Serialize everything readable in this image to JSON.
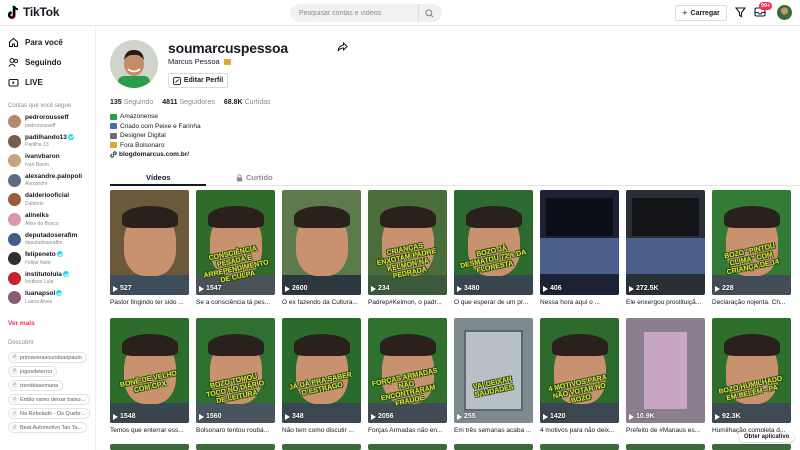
{
  "header": {
    "logo_text": "TikTok",
    "search_placeholder": "Pesquisar contas e vídeos",
    "upload_label": "Carregar",
    "inbox_badge": "99+"
  },
  "sidebar": {
    "nav": [
      {
        "label": "Para você",
        "icon": "home-icon"
      },
      {
        "label": "Seguindo",
        "icon": "following-icon"
      },
      {
        "label": "LIVE",
        "icon": "live-icon"
      }
    ],
    "following_title": "Contas que você segue",
    "accounts": [
      {
        "name": "pedrorousseff",
        "sub": "pedrorousseff",
        "verified": false,
        "color": "#b58a6a"
      },
      {
        "name": "padilhando13",
        "sub": "Padilha 13",
        "verified": true,
        "color": "#7a5c4a"
      },
      {
        "name": "ivanvbaron",
        "sub": "Ivan Baron",
        "verified": false,
        "color": "#c7a37f"
      },
      {
        "name": "alexandre.palopoli",
        "sub": "Alexandre",
        "verified": false,
        "color": "#5b6d7e"
      },
      {
        "name": "dalderiooficial",
        "sub": "Dalderio",
        "verified": false,
        "color": "#9c5a3e"
      },
      {
        "name": "alinelks",
        "sub": "Aline do Bosco",
        "verified": false,
        "color": "#d69aa8"
      },
      {
        "name": "deputadoserafim",
        "sub": "deputadoserafim",
        "verified": false,
        "color": "#3c5f8c"
      },
      {
        "name": "felipeneto",
        "sub": "Felipe Neto",
        "verified": true,
        "color": "#2f2f34"
      },
      {
        "name": "institutolula",
        "sub": "Instituto Lula",
        "verified": true,
        "color": "#c8222c"
      },
      {
        "name": "luanapsol",
        "sub": "Luana Alves",
        "verified": true,
        "color": "#8c5a73"
      }
    ],
    "see_more": "Ver mais",
    "discover_title": "Descobrir",
    "discover": [
      {
        "label": "primaverasoundsaopaulo",
        "icon": "#"
      },
      {
        "label": "jogosdeterror",
        "icon": "#"
      },
      {
        "label": "trenddasemana",
        "icon": "#"
      },
      {
        "label": "Então vamo deixar baixo...",
        "icon": "♫"
      },
      {
        "label": "Na Rebolado - Os Quebr...",
        "icon": "♫"
      },
      {
        "label": "Beat Automotivo Tan Ta...",
        "icon": "♫"
      }
    ]
  },
  "profile": {
    "username": "soumarcuspessoa",
    "display_name": "Marcus Pessoa",
    "edit_label": "Editar Perfil",
    "stats": [
      {
        "value": "135",
        "label": "Seguindo"
      },
      {
        "value": "4811",
        "label": "Seguidores"
      },
      {
        "value": "68.8K",
        "label": "Curtidas"
      }
    ],
    "bio": [
      {
        "text": "Amazonense",
        "color": "#2e9d3a"
      },
      {
        "text": "Criado com Peixe e Farinha",
        "color": "#4a6fb0"
      },
      {
        "text": "Designer Digital",
        "color": "#6b6b6b"
      },
      {
        "text": "Fora Bolsonaro",
        "color": "#e0a82e"
      }
    ],
    "link": "blogdomarcus.com.br/"
  },
  "tabs": {
    "videos": "Vídeos",
    "liked": "Curtido"
  },
  "videos": [
    {
      "plays": "527",
      "caption": "Pastor fingindo ter sido ...",
      "overlay": "",
      "bg": "#6b5a3a",
      "shirt": "#3e4d5c"
    },
    {
      "plays": "1547",
      "caption": "Se a consciência tá pes...",
      "overlay": "CONSCIÊNCIA PESADA É ARREPENDIMENTO DE CULPA",
      "bg": "#2f6b2a",
      "shirt": "#4a5358"
    },
    {
      "plays": "2600",
      "caption": "O ex fazendo da Cultura...",
      "overlay": "",
      "bg": "#5c7a4c",
      "shirt": "#2e3740"
    },
    {
      "plays": "234",
      "caption": "Padrep#Kelmon, o padr...",
      "overlay": "CRIANÇAS ENXOTAM PADRE KELMON NA PEDRADA",
      "bg": "#4a6e3a",
      "shirt": "#3b5a3a"
    },
    {
      "plays": "3480",
      "caption": "O que esperar de um pr...",
      "overlay": "BOZO JÁ DESMATOU 72% DA FLORESTA",
      "bg": "#2c6a2f",
      "shirt": "#39464f"
    },
    {
      "plays": "406",
      "caption": "Nessa hora aqui o ...",
      "overlay": "",
      "bg": "#1c2233",
      "shirt": "#1c2233"
    },
    {
      "plays": "272.5K",
      "caption": "Ele enxergou prostituiçã...",
      "overlay": "",
      "bg": "#2a2e36",
      "shirt": "#2a2e36"
    },
    {
      "plays": "228",
      "caption": "Declaração nojenta. Ch...",
      "overlay": "BOZO \"PINTOU CLIMA\" COM CRIANÇA DE 14",
      "bg": "#327a35",
      "shirt": "#424d58"
    },
    {
      "plays": "1548",
      "caption": "Temos que enterrar ess...",
      "overlay": "BONÉ DE VELHO COM CPX",
      "bg": "#2d6d2c",
      "shirt": "#39454f"
    },
    {
      "plays": "1560",
      "caption": "Bolsonaro tentou roubá...",
      "overlay": "BOZO TOMOU TOCO NO DIÁRIO DE LEITURA",
      "bg": "#2f7030",
      "shirt": "#48545e"
    },
    {
      "plays": "348",
      "caption": "Não tem como discutir ...",
      "overlay": "JÁ DÁ PRA SABER O ESTRAGO",
      "bg": "#2a6b2c",
      "shirt": "#3a4650"
    },
    {
      "plays": "2056",
      "caption": "Forças Armadas não en...",
      "overlay": "FORÇAS ARMADAS NÃO ENCONTRARAM FRAUDE",
      "bg": "#31712f",
      "shirt": "#404b55"
    },
    {
      "plays": "255",
      "caption": "Em três semanas acaba ...",
      "overlay": "VAI DEIXAR SAUDADES",
      "bg": "#7d8a90",
      "shirt": "#6a7378"
    },
    {
      "plays": "1420",
      "caption": "4 motivos para não deix...",
      "overlay": "4 MOTIVOS PARA NÃO VOTAR NO BOZO",
      "bg": "#2d6b2d",
      "shirt": "#3a4650"
    },
    {
      "plays": "10.9K",
      "caption": "Prefeito de #Manaus es...",
      "overlay": "",
      "bg": "#8a7f8e",
      "shirt": "#6a5f70"
    },
    {
      "plays": "92.3K",
      "caption": "Humilhação completa d...",
      "overlay": "BOZO HUMILHADO EM BELÉM - PA",
      "bg": "#2f6f2e",
      "shirt": "#3e4a54"
    }
  ],
  "get_app": "Obter aplicativo"
}
